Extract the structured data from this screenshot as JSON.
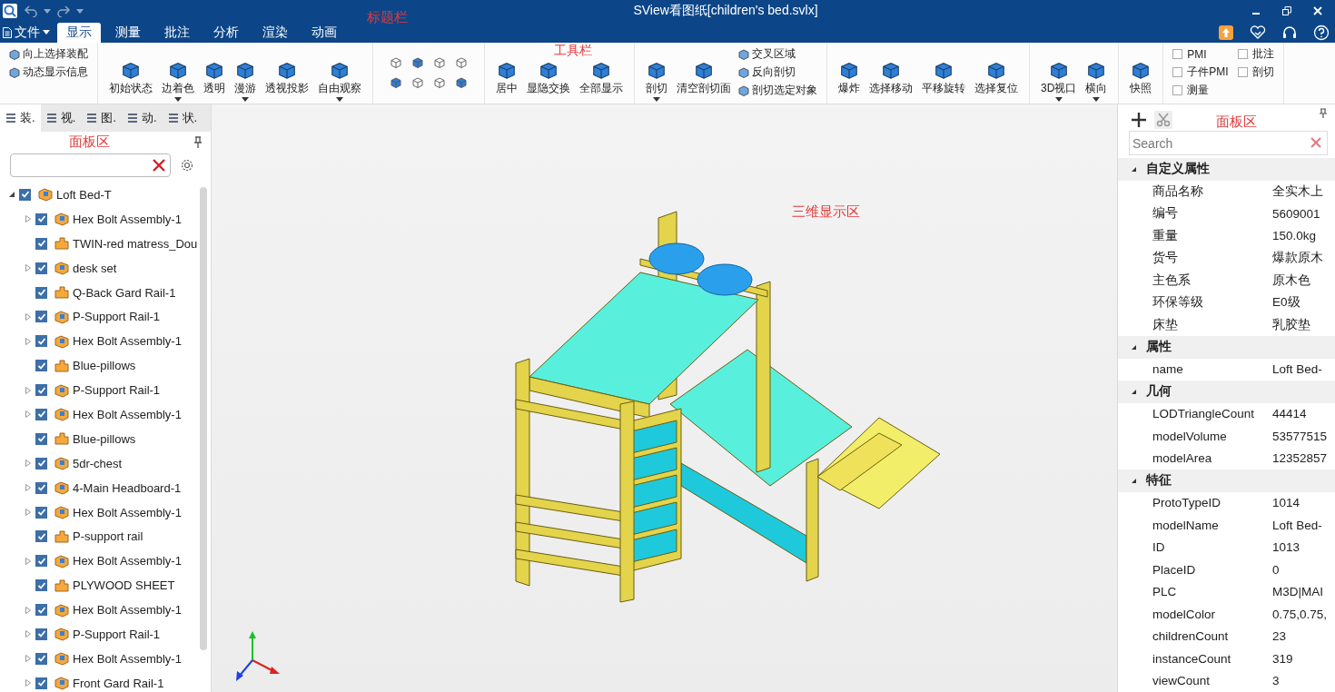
{
  "title_bar": {
    "title": "SView看图纸[children's bed.svlx]",
    "annotation": "标题栏"
  },
  "menu_bar": {
    "file_menu": "文件",
    "tabs": [
      {
        "label": "显示",
        "selected": true
      },
      {
        "label": "测量",
        "selected": false
      },
      {
        "label": "批注",
        "selected": false
      },
      {
        "label": "分析",
        "selected": false
      },
      {
        "label": "渲染",
        "selected": false
      },
      {
        "label": "动画",
        "selected": false
      }
    ]
  },
  "toolbar": {
    "annotation": "工具栏",
    "groups": [
      {
        "kind": "buttons",
        "items": [
          {
            "kind": "small",
            "label": "向上选择装配"
          },
          {
            "kind": "small",
            "label": "动态显示信息"
          }
        ]
      },
      {
        "kind": "buttons",
        "items": [
          {
            "kind": "large",
            "label": "初始状态",
            "dropdown": false
          },
          {
            "kind": "large",
            "label": "边着色",
            "dropdown": true
          },
          {
            "kind": "large",
            "label": "透明",
            "dropdown": false
          },
          {
            "kind": "large",
            "label": "漫游",
            "dropdown": true
          },
          {
            "kind": "large",
            "label": "透视投影",
            "dropdown": false
          },
          {
            "kind": "large",
            "label": "自由观察",
            "dropdown": true
          }
        ]
      },
      {
        "kind": "view_grid"
      },
      {
        "kind": "buttons",
        "items": [
          {
            "kind": "large",
            "label": "居中",
            "dropdown": false
          },
          {
            "kind": "large",
            "label": "显隐交换",
            "dropdown": false
          },
          {
            "kind": "large",
            "label": "全部显示",
            "dropdown": false
          }
        ]
      },
      {
        "kind": "buttons",
        "items": [
          {
            "kind": "large",
            "label": "剖切",
            "dropdown": true
          },
          {
            "kind": "large",
            "label": "清空剖切面",
            "dropdown": false
          },
          {
            "kind": "small",
            "label": "交叉区域"
          },
          {
            "kind": "small",
            "label": "反向剖切"
          },
          {
            "kind": "small",
            "label": "剖切选定对象"
          }
        ]
      },
      {
        "kind": "buttons",
        "items": [
          {
            "kind": "large",
            "label": "爆炸",
            "dropdown": false
          },
          {
            "kind": "large",
            "label": "选择移动",
            "dropdown": false
          },
          {
            "kind": "large",
            "label": "平移旋转",
            "dropdown": false
          },
          {
            "kind": "large",
            "label": "选择复位",
            "dropdown": false
          }
        ]
      },
      {
        "kind": "buttons",
        "items": [
          {
            "kind": "large",
            "label": "3D视口",
            "dropdown": true
          },
          {
            "kind": "large",
            "label": "横向",
            "dropdown": true
          }
        ]
      },
      {
        "kind": "buttons",
        "items": [
          {
            "kind": "large",
            "label": "快照",
            "dropdown": false
          }
        ]
      },
      {
        "kind": "buttons",
        "items": [
          {
            "kind": "checkbox",
            "label": "PMI",
            "checked": false
          },
          {
            "kind": "checkbox",
            "label": "子件PMI",
            "checked": false
          },
          {
            "kind": "checkbox",
            "label": "测量",
            "checked": false
          },
          {
            "kind": "checkbox",
            "label": "批注",
            "checked": false
          },
          {
            "kind": "checkbox",
            "label": "剖切",
            "checked": false
          }
        ]
      }
    ]
  },
  "left_panel": {
    "annotation": "面板区",
    "tabs": [
      {
        "label": "装.",
        "selected": true
      },
      {
        "label": "视.",
        "selected": false
      },
      {
        "label": "图.",
        "selected": false
      },
      {
        "label": "动.",
        "selected": false
      },
      {
        "label": "状.",
        "selected": false
      }
    ],
    "tree": [
      {
        "label": "Loft Bed-T",
        "kind": "assembly",
        "checked": true,
        "expanded": true,
        "children": [
          {
            "label": "Hex Bolt Assembly-1",
            "kind": "assembly",
            "checked": true,
            "expanded": false
          },
          {
            "label": "TWIN-red matress_Dou",
            "kind": "part",
            "checked": true
          },
          {
            "label": "desk set",
            "kind": "assembly",
            "checked": true,
            "expanded": false
          },
          {
            "label": "Q-Back Gard Rail-1",
            "kind": "part",
            "checked": true
          },
          {
            "label": "P-Support Rail-1",
            "kind": "assembly",
            "checked": true,
            "expanded": false
          },
          {
            "label": "Hex Bolt Assembly-1",
            "kind": "assembly",
            "checked": true,
            "expanded": false
          },
          {
            "label": "Blue-pillows",
            "kind": "part",
            "checked": true
          },
          {
            "label": "P-Support Rail-1",
            "kind": "assembly",
            "checked": true,
            "expanded": false
          },
          {
            "label": "Hex Bolt Assembly-1",
            "kind": "assembly",
            "checked": true,
            "expanded": false
          },
          {
            "label": "Blue-pillows",
            "kind": "part",
            "checked": true
          },
          {
            "label": "5dr-chest",
            "kind": "assembly",
            "checked": true,
            "expanded": false
          },
          {
            "label": "4-Main Headboard-1",
            "kind": "assembly",
            "checked": true,
            "expanded": false
          },
          {
            "label": "Hex Bolt Assembly-1",
            "kind": "assembly",
            "checked": true,
            "expanded": false
          },
          {
            "label": "P-support rail",
            "kind": "part",
            "checked": true
          },
          {
            "label": "Hex Bolt Assembly-1",
            "kind": "assembly",
            "checked": true,
            "expanded": false
          },
          {
            "label": "PLYWOOD SHEET",
            "kind": "part",
            "checked": true
          },
          {
            "label": "Hex Bolt Assembly-1",
            "kind": "assembly",
            "checked": true,
            "expanded": false
          },
          {
            "label": "P-Support Rail-1",
            "kind": "assembly",
            "checked": true,
            "expanded": false
          },
          {
            "label": "Hex Bolt Assembly-1",
            "kind": "assembly",
            "checked": true,
            "expanded": false
          },
          {
            "label": "Front Gard Rail-1",
            "kind": "assembly",
            "checked": true,
            "expanded": false
          }
        ]
      }
    ]
  },
  "viewport": {
    "annotation": "三维显示区"
  },
  "right_panel": {
    "annotation": "面板区",
    "search": {
      "placeholder": "Search"
    },
    "groups": [
      {
        "title": "自定义属性",
        "expanded": true,
        "rows": [
          {
            "name": "商品名称",
            "value": "全实木上"
          },
          {
            "name": "编号",
            "value": "5609001"
          },
          {
            "name": "重量",
            "value": "150.0kg"
          },
          {
            "name": "货号",
            "value": "爆款原木"
          },
          {
            "name": "主色系",
            "value": "原木色"
          },
          {
            "name": "环保等级",
            "value": "E0级"
          },
          {
            "name": "床垫",
            "value": "乳胶垫"
          }
        ]
      },
      {
        "title": "属性",
        "expanded": true,
        "rows": [
          {
            "name": "name",
            "value": "Loft Bed-"
          }
        ]
      },
      {
        "title": "几何",
        "expanded": true,
        "rows": [
          {
            "name": "LODTriangleCount",
            "value": "44414"
          },
          {
            "name": "modelVolume",
            "value": "53577515"
          },
          {
            "name": "modelArea",
            "value": "12352857"
          }
        ]
      },
      {
        "title": "特征",
        "expanded": true,
        "rows": [
          {
            "name": "ProtoTypeID",
            "value": "1014"
          },
          {
            "name": "modelName",
            "value": "Loft Bed-"
          },
          {
            "name": "ID",
            "value": "1013"
          },
          {
            "name": "PlaceID",
            "value": "0"
          },
          {
            "name": "PLC",
            "value": "M3D|MAI"
          },
          {
            "name": "modelColor",
            "value": "0.75,0.75,"
          },
          {
            "name": "childrenCount",
            "value": "23"
          },
          {
            "name": "instanceCount",
            "value": "319"
          },
          {
            "name": "viewCount",
            "value": "3"
          }
        ]
      }
    ]
  }
}
